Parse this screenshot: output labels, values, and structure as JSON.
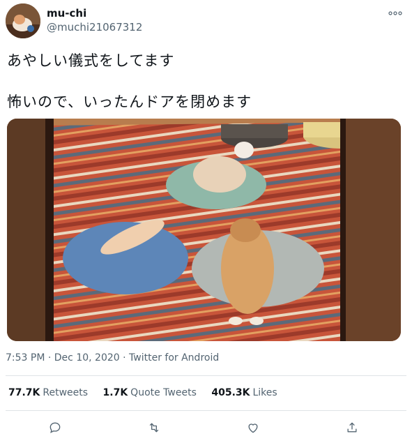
{
  "tweet": {
    "display_name": "mu-chi",
    "handle": "@muchi21067312",
    "text_line1": "あやしい儀式をしてます",
    "text_line2": "怖いので、いったんドアを閉めます",
    "time": "7:53 PM",
    "date": "Dec 10, 2020",
    "separator": "·",
    "source": "Twitter for Android"
  },
  "stats": {
    "retweets_count": "77.7K",
    "retweets_label": "Retweets",
    "quote_count": "1.7K",
    "quote_label": "Quote Tweets",
    "likes_count": "405.3K",
    "likes_label": "Likes"
  },
  "icons": {
    "more": "more-horizontal-icon",
    "reply": "reply-icon",
    "retweet": "retweet-icon",
    "like": "like-icon",
    "share": "share-icon"
  },
  "colors": {
    "text_primary": "#0f1419",
    "text_secondary": "#536471",
    "divider": "#dfe3e7"
  }
}
